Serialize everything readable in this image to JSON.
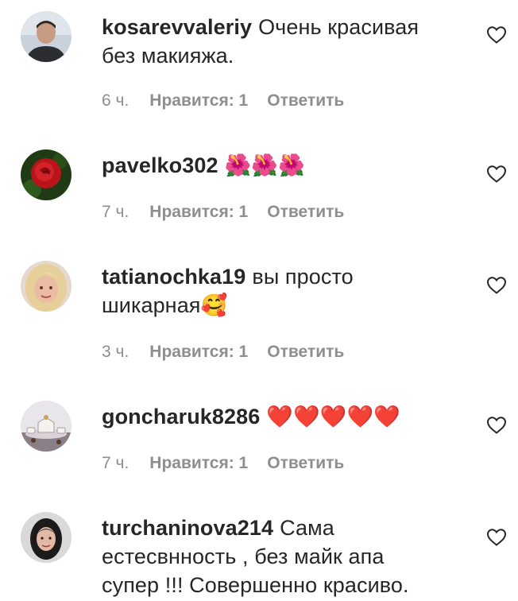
{
  "comments": [
    {
      "username": "kosarevvaleriy",
      "text_line1": "Очень красивая",
      "text_line2": "без макияжа.",
      "time": "6 ч.",
      "likes": "Нравится: 1",
      "reply": "Ответить",
      "avatar_icon": "man-portrait-avatar"
    },
    {
      "username": "pavelko302",
      "text_line1": "🌺🌺🌺",
      "text_line2": "",
      "time": "7 ч.",
      "likes": "Нравится: 1",
      "reply": "Ответить",
      "avatar_icon": "red-rose-avatar"
    },
    {
      "username": "tatianochka19",
      "text_line1": "вы просто",
      "text_line2": "шикарная🥰",
      "time": "3 ч.",
      "likes": "Нравится: 1",
      "reply": "Ответить",
      "avatar_icon": "woman-blonde-avatar"
    },
    {
      "username": "goncharuk8286",
      "text_line1": "❤️❤️❤️❤️❤️",
      "text_line2": "",
      "time": "7 ч.",
      "likes": "Нравится: 1",
      "reply": "Ответить",
      "avatar_icon": "tea-set-avatar"
    },
    {
      "username": "turchaninova214",
      "text_line1": "Сама",
      "text_line2": "естесвнность , без майк апа",
      "text_line3": "супер !!! Совершенно красиво.",
      "avatar_icon": "woman-dark-hair-avatar"
    }
  ],
  "icons": {
    "like": "heart-outline-icon"
  },
  "colors": {
    "text": "#262626",
    "meta": "#8e8e8e",
    "background": "#ffffff"
  }
}
